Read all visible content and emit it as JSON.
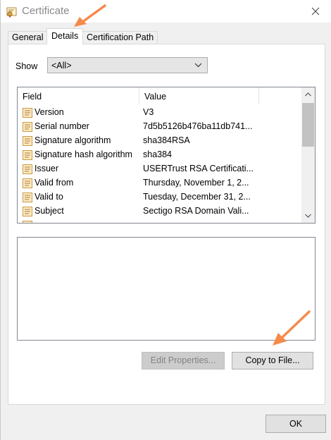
{
  "window": {
    "title": "Certificate"
  },
  "tabs": [
    {
      "label": "General"
    },
    {
      "label": "Details"
    },
    {
      "label": "Certification Path"
    }
  ],
  "show": {
    "label": "Show",
    "value": "<All>"
  },
  "list": {
    "columns": {
      "field": "Field",
      "value": "Value"
    },
    "rows": [
      {
        "field": "Version",
        "value": "V3"
      },
      {
        "field": "Serial number",
        "value": "7d5b5126b476ba11db741..."
      },
      {
        "field": "Signature algorithm",
        "value": "sha384RSA"
      },
      {
        "field": "Signature hash algorithm",
        "value": "sha384"
      },
      {
        "field": "Issuer",
        "value": "USERTrust RSA Certificati..."
      },
      {
        "field": "Valid from",
        "value": "Thursday, November 1, 2..."
      },
      {
        "field": "Valid to",
        "value": "Tuesday, December 31, 2..."
      },
      {
        "field": "Subject",
        "value": "Sectigo RSA Domain Vali..."
      }
    ]
  },
  "buttons": {
    "edit_properties": "Edit Properties...",
    "copy_to_file": "Copy to File...",
    "ok": "OK"
  },
  "colors": {
    "annotation_arrow": "#f58a4b",
    "cert_icon": "#d6a44a"
  },
  "icons": {
    "close": "close-icon",
    "certificate": "certificate-icon",
    "field": "field-icon"
  }
}
